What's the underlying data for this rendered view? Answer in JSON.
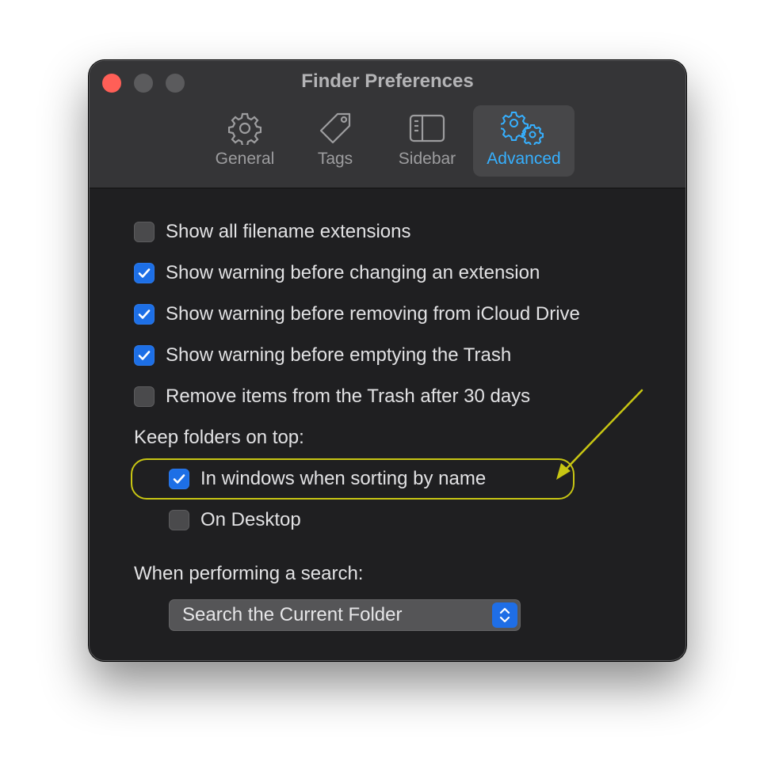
{
  "window": {
    "title": "Finder Preferences"
  },
  "toolbar": {
    "tabs": [
      {
        "label": "General",
        "icon": "gear-icon",
        "active": false
      },
      {
        "label": "Tags",
        "icon": "tag-icon",
        "active": false
      },
      {
        "label": "Sidebar",
        "icon": "sidebar-icon",
        "active": false
      },
      {
        "label": "Advanced",
        "icon": "gears-icon",
        "active": true
      }
    ]
  },
  "options": [
    {
      "label": "Show all filename extensions",
      "checked": false
    },
    {
      "label": "Show warning before changing an extension",
      "checked": true
    },
    {
      "label": "Show warning before removing from iCloud Drive",
      "checked": true
    },
    {
      "label": "Show warning before emptying the Trash",
      "checked": true
    },
    {
      "label": "Remove items from the Trash after 30 days",
      "checked": false
    }
  ],
  "keep_folders": {
    "heading": "Keep folders on top:",
    "options": [
      {
        "label": "In windows when sorting by name",
        "checked": true
      },
      {
        "label": "On Desktop",
        "checked": false
      }
    ]
  },
  "search": {
    "heading": "When performing a search:",
    "selected": "Search the Current Folder"
  },
  "colors": {
    "accent": "#1d6fe6",
    "active_tab_text": "#36b0ff",
    "annotation": "#c8c613"
  }
}
